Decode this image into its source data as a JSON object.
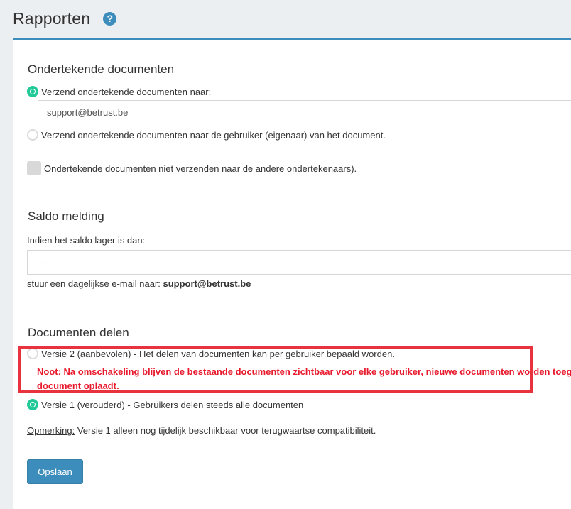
{
  "header": {
    "title": "Rapporten",
    "help_icon": "question-circle-icon"
  },
  "signed_documents": {
    "title": "Ondertekende documenten",
    "option_send_to_label": "Verzend ondertekende documenten naar:",
    "option_send_to_checked": true,
    "email_value": "support@betrust.be",
    "option_send_to_owner_label": "Verzend ondertekende documenten naar de gebruiker (eigenaar) van het document.",
    "option_send_to_owner_checked": false,
    "no_send_checkbox": {
      "label_before": "Ondertekende documenten ",
      "label_emphasis": "niet",
      "label_after": " verzenden naar de andere ondertekenaars).",
      "checked": false
    }
  },
  "balance_alert": {
    "title": "Saldo melding",
    "threshold_label": "Indien het saldo lager is dan:",
    "threshold_value": "--",
    "email_text_prefix": "stuur een dagelijkse e-mail naar: ",
    "email": "support@betrust.be"
  },
  "document_sharing": {
    "title": "Documenten delen",
    "version2_label": "Versie 2 (aanbevolen) - Het delen van documenten kan per gebruiker bepaald worden.",
    "version2_checked": false,
    "version2_note_line1": "Noot: Na omschakeling blijven de bestaande documenten zichtbaar voor elke gebruiker, nieuwe documenten worden toege",
    "version2_note_line2": "document oplaadt.",
    "version1_label": "Versie 1 (verouderd) - Gebruikers delen steeds alle documenten",
    "version1_checked": true,
    "remark_label": "Opmerking:",
    "remark_text": " Versie 1 alleen nog tijdelijk beschikbaar voor terugwaartse compatibiliteit."
  },
  "actions": {
    "save_label": "Opslaan"
  },
  "colors": {
    "accent": "#3c8dbc",
    "radio_checked": "#20c997",
    "warning": "#e8192c",
    "highlight_border": "#e8333f"
  }
}
